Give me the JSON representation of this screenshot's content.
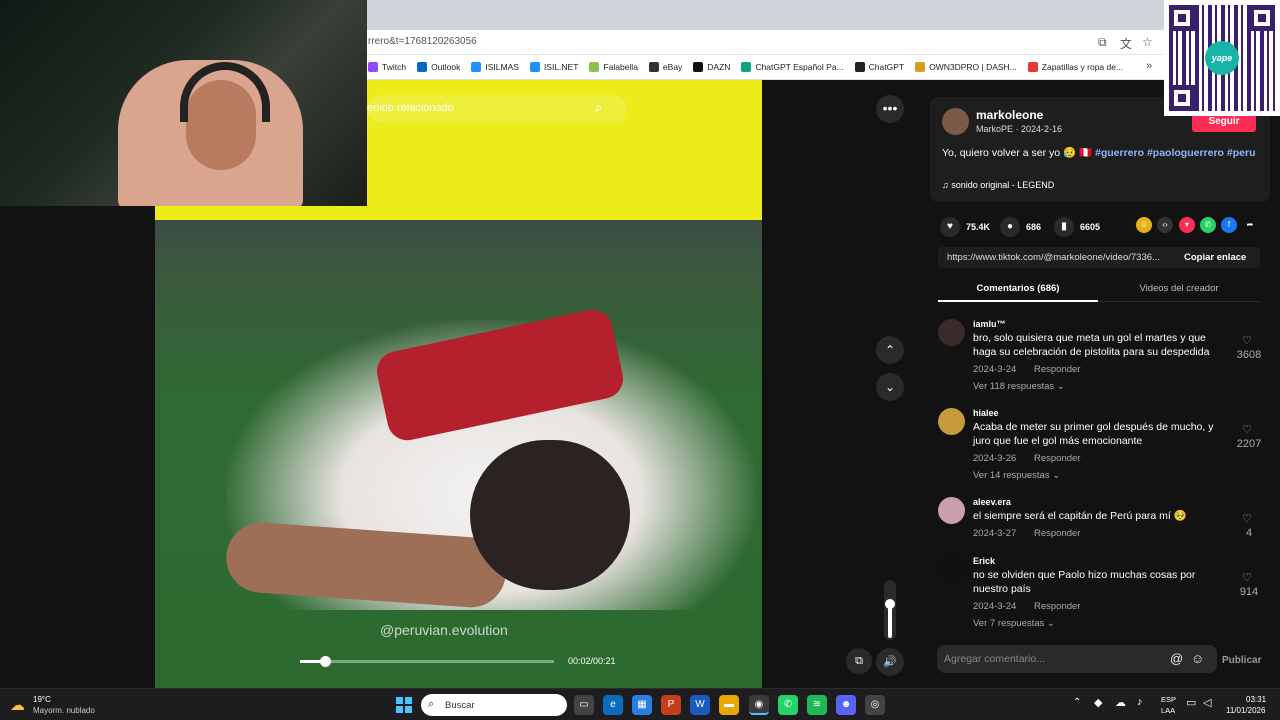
{
  "browser": {
    "url": "rrero&t=1768120263056",
    "bookmarks": [
      {
        "label": "Twitch",
        "color": "#9146ff"
      },
      {
        "label": "Outlook",
        "color": "#0a66c2"
      },
      {
        "label": "ISILMAS",
        "color": "#1e90ff"
      },
      {
        "label": "ISIL.NET",
        "color": "#1e90ff"
      },
      {
        "label": "Falabella",
        "color": "#8bc34a"
      },
      {
        "label": "eBay",
        "color": "#333333"
      },
      {
        "label": "DAZN",
        "color": "#111111"
      },
      {
        "label": "ChatGPT Español Pa...",
        "color": "#10a37f"
      },
      {
        "label": "ChatGPT",
        "color": "#222222"
      },
      {
        "label": "OWN3DPRO | DASH...",
        "color": "#d4a017"
      },
      {
        "label": "Zapatillas y ropa de...",
        "color": "#e53935"
      }
    ],
    "bookmarks_more": "»"
  },
  "qr": {
    "logo_text": "yape"
  },
  "video": {
    "search_placeholder": "enido relacionado",
    "watermark": "@peruvian.evolution",
    "timestamp": "00:02/00:21",
    "progress": 0.1,
    "volume": 0.6
  },
  "post": {
    "username": "markoleone",
    "nickname_line": "MarkoPE · 2024-2-16",
    "follow_label": "Seguir",
    "desc_text": "Yo, quiero volver a ser yo 😥 🇵🇪 ",
    "tags": [
      "#guerrero",
      "#paologuerrero",
      "#peru"
    ],
    "music": "♫  sonido original - LEGEND",
    "likes": "75.4K",
    "comments": "686",
    "saves": "6605",
    "link": "https://www.tiktok.com/@markoleone/video/7336...",
    "copy_label": "Copiar enlace",
    "tab_comments": "Comentarios (686)",
    "tab_videos": "Videos del creador"
  },
  "comments": [
    {
      "user": "iamlu™",
      "text": "bro, solo quisiera que meta un gol el martes y que haga su celebración de pistolita para su despedida",
      "date": "2024-3-24",
      "reply": "Responder",
      "more": "Ver 118 respuestas ⌄",
      "likes": "3608",
      "avatar": "#3b2a2a"
    },
    {
      "user": "hialee",
      "text": "Acaba de meter su primer gol después de mucho, y juro que fue el gol más emocionante",
      "date": "2024-3-26",
      "reply": "Responder",
      "more": "Ver 14 respuestas ⌄",
      "likes": "2207",
      "avatar": "#c49a3c"
    },
    {
      "user": "aleev.era",
      "text": "el siempre será el capitán de Perú para mí 🥺",
      "date": "2024-3-27",
      "reply": "Responder",
      "more": "",
      "likes": "4",
      "avatar": "#caa0b0"
    },
    {
      "user": "Erick",
      "text": "no se olviden que Paolo hizo muchas cosas por nuestro país",
      "date": "2024-3-24",
      "reply": "Responder",
      "more": "Ver 7 respuestas ⌄",
      "likes": "914",
      "avatar": "#111111"
    }
  ],
  "composer": {
    "placeholder": "Agregar comentario...",
    "at": "@",
    "emoji": "☺",
    "publish": "Publicar"
  },
  "taskbar": {
    "temp": "19°C",
    "weather": "Mayorm. nublado",
    "search": "Buscar",
    "lang1": "ESP",
    "lang2": "LAA",
    "time": "03:31",
    "date": "11/01/2026"
  }
}
